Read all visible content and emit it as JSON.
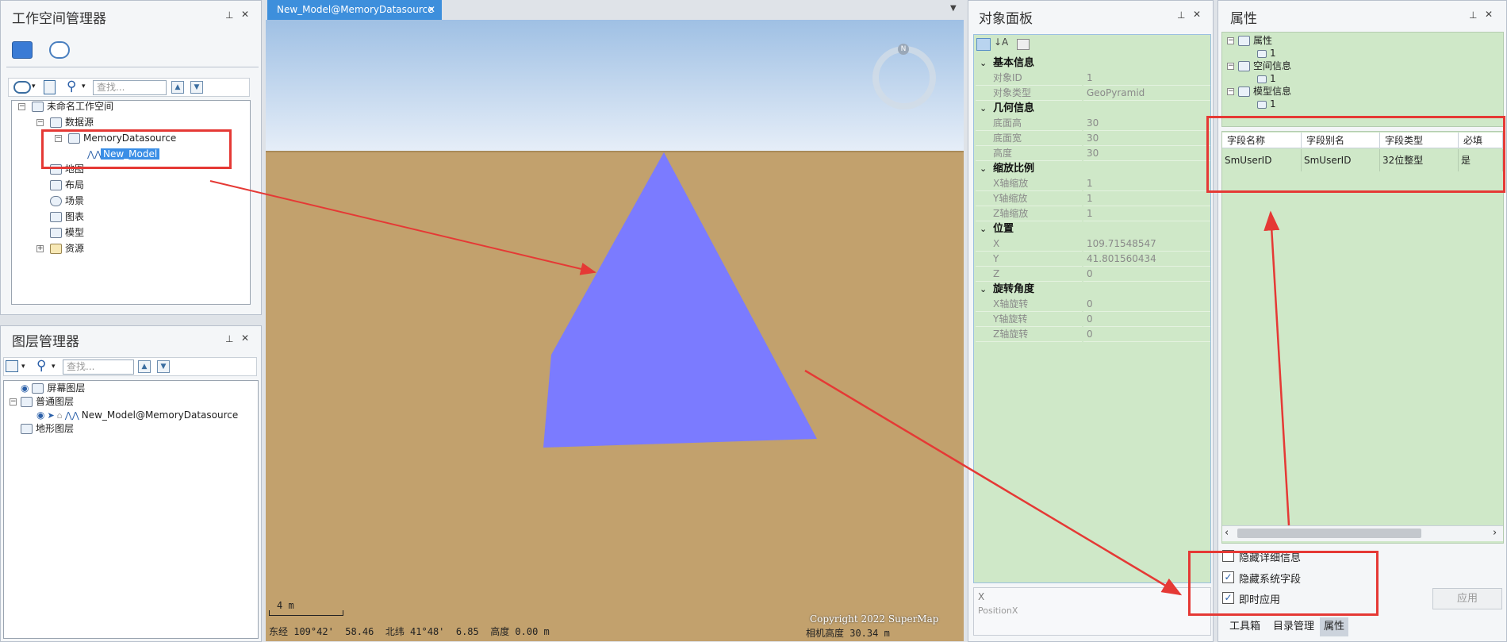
{
  "workspace_panel": {
    "title": "工作空间管理器",
    "pin": "📌",
    "close": "✕",
    "search_placeholder": "查找...",
    "tree": {
      "root": "未命名工作空间",
      "datasources": "数据源",
      "memory_ds": "MemoryDatasource",
      "new_model": "New_Model",
      "maps": "地图",
      "layouts": "布局",
      "scenes": "场景",
      "charts": "图表",
      "models": "模型",
      "resources": "资源"
    }
  },
  "layer_panel": {
    "title": "图层管理器",
    "pin": "📌",
    "close": "✕",
    "search_placeholder": "查找...",
    "tree": {
      "screen_layer": "屏幕图层",
      "normal_layer": "普通图层",
      "model_layer": "New_Model@MemoryDatasource",
      "terrain_layer": "地形图层"
    }
  },
  "scene": {
    "tab_label": "New_Model@MemoryDatasource",
    "tab_close": "✕",
    "compass_n": "N",
    "scale_label": "4 m",
    "status": "东经 109°42'  58.46  北纬 41°48'  6.85  高度 0.00 m",
    "copyright": "Copyright 2022 SuperMap",
    "camera_height": "相机高度 30.34 m",
    "colors": {
      "sky_top": "#9fc0e4",
      "sky_bottom": "#e6eef8",
      "ground": "#c2a16d",
      "pyramid": "#7b7bff"
    }
  },
  "object_panel": {
    "title": "对象面板",
    "pin": "📌",
    "close": "✕",
    "groups": {
      "basic": "基本信息",
      "geometry": "几何信息",
      "scale": "缩放比例",
      "position": "位置",
      "rotation": "旋转角度"
    },
    "rows": {
      "object_id": [
        "对象ID",
        "1"
      ],
      "object_type": [
        "对象类型",
        "GeoPyramid"
      ],
      "base_height": [
        "底面高",
        "30"
      ],
      "base_width": [
        "底面宽",
        "30"
      ],
      "height": [
        "高度",
        "30"
      ],
      "x_scale": [
        "X轴缩放",
        "1"
      ],
      "y_scale": [
        "Y轴缩放",
        "1"
      ],
      "z_scale": [
        "Z轴缩放",
        "1"
      ],
      "x": [
        "X",
        "109.71548547"
      ],
      "y": [
        "Y",
        "41.801560434"
      ],
      "z": [
        "Z",
        "0"
      ],
      "x_rot": [
        "X轴旋转",
        "0"
      ],
      "y_rot": [
        "Y轴旋转",
        "0"
      ],
      "z_rot": [
        "Z轴旋转",
        "0"
      ]
    },
    "desc_title": "X",
    "desc_text": "PositionX"
  },
  "attr_panel": {
    "title": "属性",
    "pin": "📌",
    "close": "✕",
    "tree": {
      "attributes": "属性",
      "spatial": "空间信息",
      "model": "模型信息",
      "child": "1"
    },
    "grid": {
      "headers": [
        "字段名称",
        "字段别名",
        "字段类型",
        "必填"
      ],
      "row": [
        "SmUserID",
        "SmUserID",
        "32位整型",
        "是"
      ]
    },
    "checkboxes": {
      "hide_detail": "隐藏详细信息",
      "hide_system": "隐藏系统字段",
      "instant_apply": "即时应用"
    },
    "apply_button": "应用",
    "bottom_tabs": [
      "工具箱",
      "目录管理",
      "属性"
    ]
  }
}
